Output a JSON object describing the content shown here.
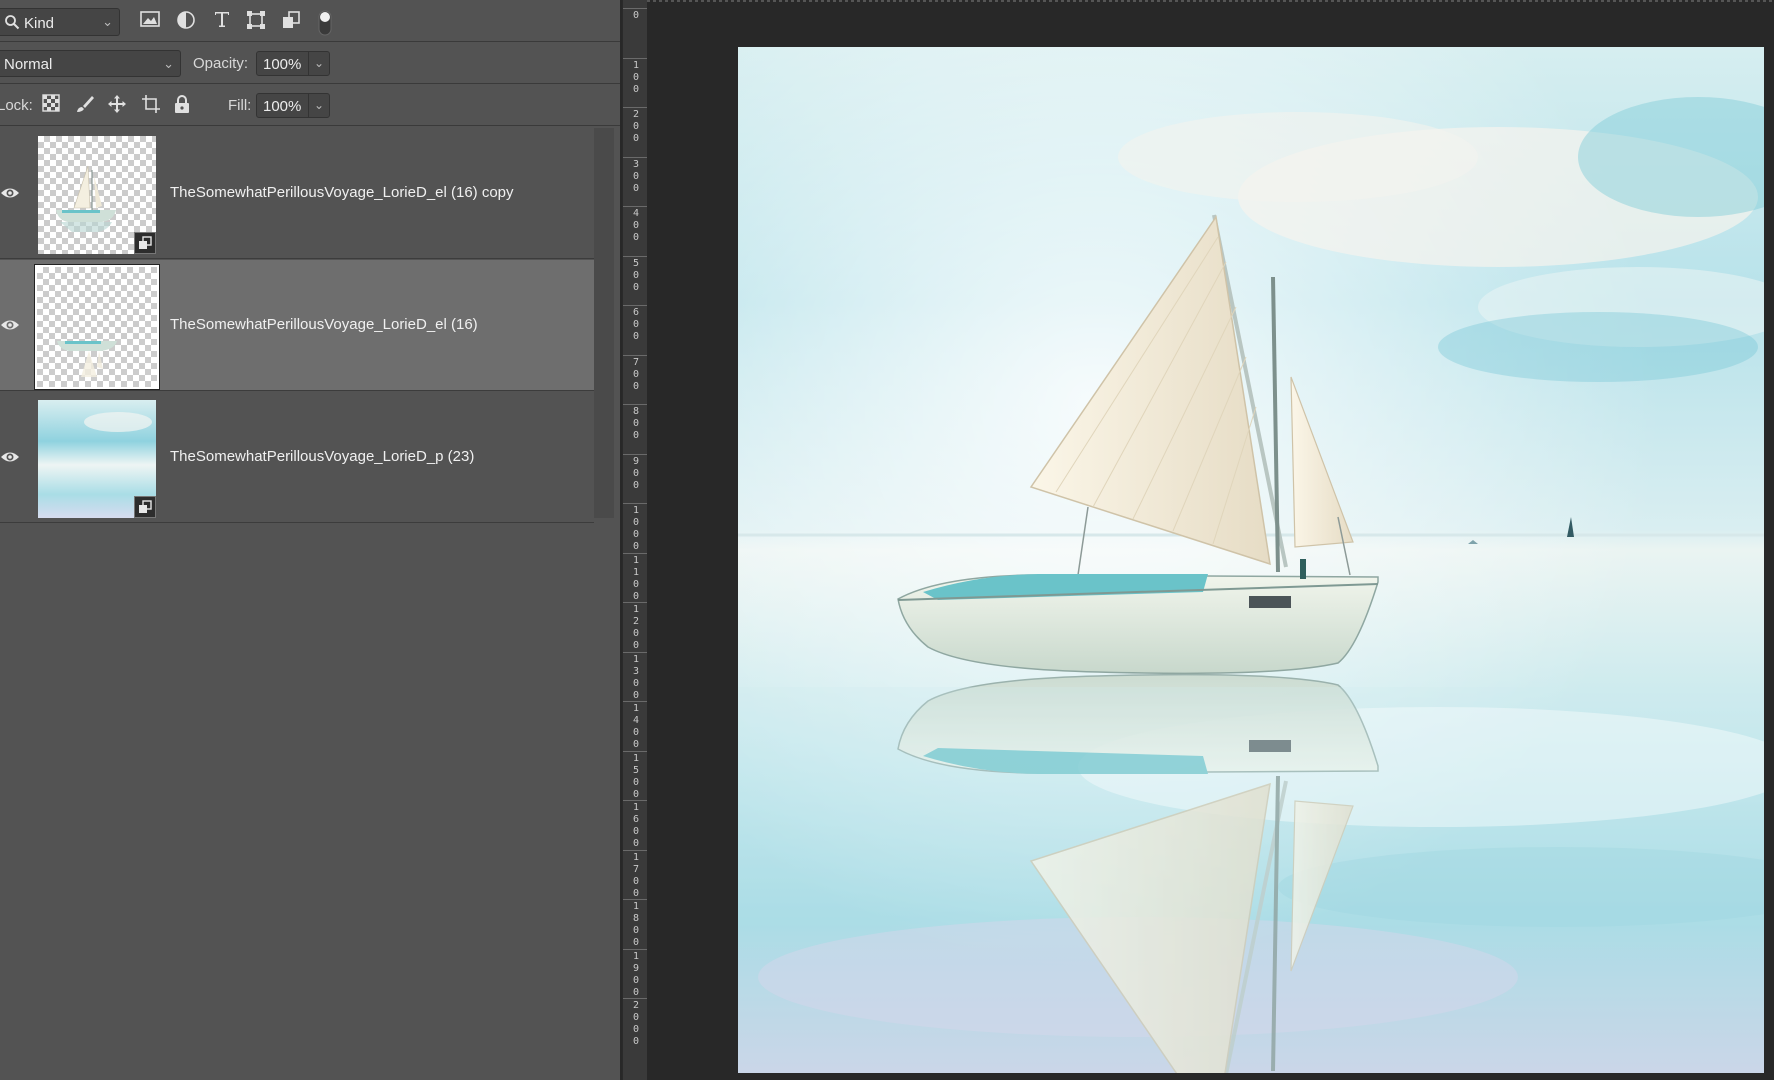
{
  "filter_bar": {
    "kind_label": "Kind",
    "icons": [
      "image-filter-icon",
      "adjustment-filter-icon",
      "type-filter-icon",
      "shape-filter-icon",
      "smart-object-filter-icon",
      "filter-toggle-icon"
    ]
  },
  "blend": {
    "mode": "Normal",
    "opacity_label": "Opacity:",
    "opacity_value": "100%"
  },
  "lock_row": {
    "label": "Lock:",
    "fill_label": "Fill:",
    "fill_value": "100%",
    "icons": [
      "lock-transparent-pixels-icon",
      "lock-image-pixels-icon",
      "lock-position-icon",
      "lock-artboard-icon",
      "lock-all-icon"
    ]
  },
  "layers": [
    {
      "name": "TheSomewhatPerillousVoyage_LorieD_el (16) copy",
      "visible": true,
      "selected": false,
      "smart_object": true
    },
    {
      "name": "TheSomewhatPerillousVoyage_LorieD_el (16)",
      "visible": true,
      "selected": true,
      "smart_object": false
    },
    {
      "name": "TheSomewhatPerillousVoyage_LorieD_p (23)",
      "visible": true,
      "selected": false,
      "smart_object": true
    }
  ],
  "ruler": {
    "labels": [
      "0",
      "100",
      "200",
      "300",
      "400",
      "500",
      "600",
      "700",
      "800",
      "900",
      "1000",
      "1100",
      "1200",
      "1300",
      "1400",
      "1500",
      "1600",
      "1700",
      "1800",
      "1900",
      "2000"
    ]
  },
  "colors": {
    "panel": "#535353",
    "selected_layer": "#6e6e6e",
    "canvas_bg": "#282828",
    "sky": "#bfe3ea",
    "water": "#9fd7e2",
    "sail": "#f3ecd9",
    "hull": "#e4ecdf"
  }
}
